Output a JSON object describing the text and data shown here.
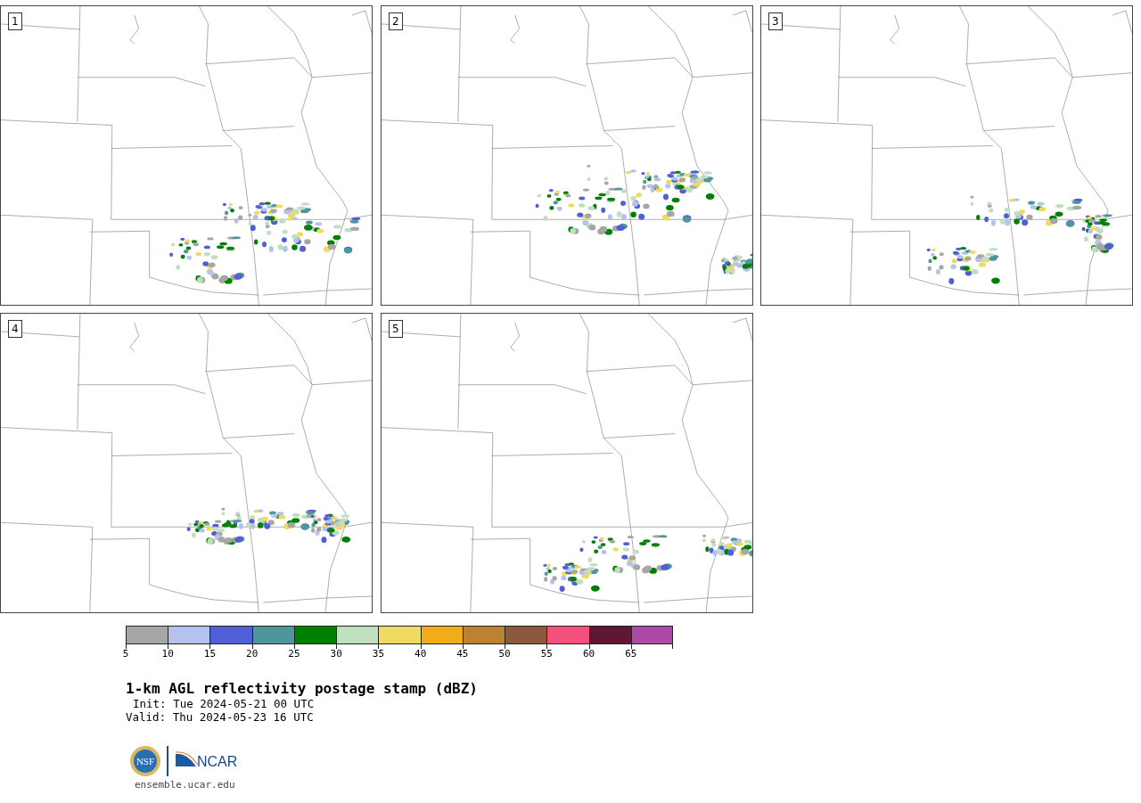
{
  "panels": [
    {
      "label": "1"
    },
    {
      "label": "2"
    },
    {
      "label": "3"
    },
    {
      "label": "4"
    },
    {
      "label": "5"
    }
  ],
  "colorbar": {
    "bins": [
      {
        "label": "5",
        "color": "#a6a6a6"
      },
      {
        "label": "10",
        "color": "#b6c2ee"
      },
      {
        "label": "15",
        "color": "#505fd6"
      },
      {
        "label": "20",
        "color": "#4f969c"
      },
      {
        "label": "25",
        "color": "#008000"
      },
      {
        "label": "30",
        "color": "#bfdfbf"
      },
      {
        "label": "35",
        "color": "#f0da60"
      },
      {
        "label": "40",
        "color": "#f0ad18"
      },
      {
        "label": "45",
        "color": "#ba8232"
      },
      {
        "label": "50",
        "color": "#8b5a3c"
      },
      {
        "label": "55",
        "color": "#f54f7d"
      },
      {
        "label": "60",
        "color": "#5e1735"
      },
      {
        "label": "65",
        "color": "#ad4aa5"
      }
    ]
  },
  "title": "1-km AGL reflectivity postage stamp (dBZ)",
  "init": "Init: Tue 2024-05-21 00 UTC",
  "valid": "Valid: Thu 2024-05-23 16 UTC",
  "logos": {
    "nsf": "NSF",
    "ncar": "NCAR"
  },
  "url": "ensemble.ucar.edu"
}
